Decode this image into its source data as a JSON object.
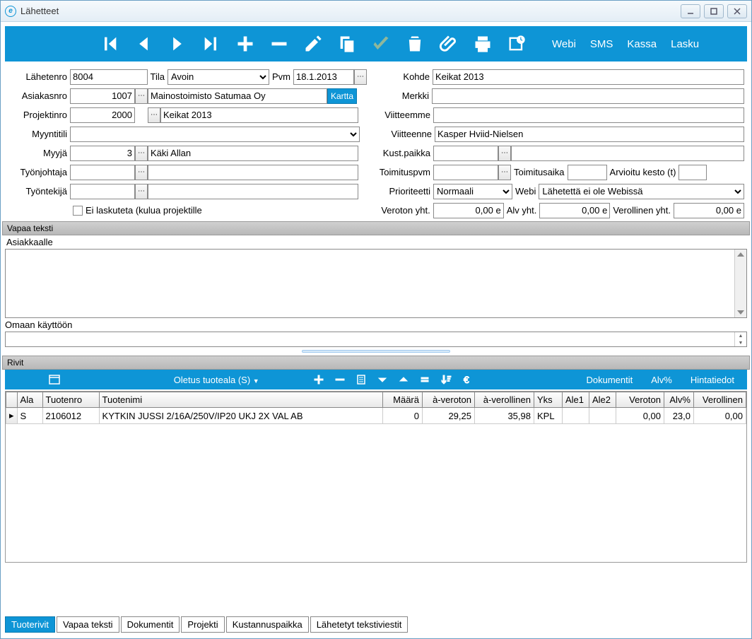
{
  "window": {
    "title": "Lähetteet"
  },
  "toolbar": {
    "links": [
      "Webi",
      "SMS",
      "Kassa",
      "Lasku"
    ]
  },
  "form": {
    "lahetenro_label": "Lähetenro",
    "lahetenro": "8004",
    "tila_label": "Tila",
    "tila": "Avoin",
    "pvm_label": "Pvm",
    "pvm": "18.1.2013",
    "kohde_label": "Kohde",
    "kohde": "Keikat 2013",
    "asiakasnro_label": "Asiakasnro",
    "asiakasnro": "1007",
    "asiakasnimi": "Mainostoimisto Satumaa Oy",
    "kartta_label": "Kartta",
    "merkki_label": "Merkki",
    "merkki": "",
    "projektinro_label": "Projektinro",
    "projektinro": "2000",
    "projektinimi": "Keikat 2013",
    "viitteemme_label": "Viitteemme",
    "viitteemme": "",
    "myyntitili_label": "Myyntitili",
    "viitteenne_label": "Viitteenne",
    "viitteenne": "Kasper Hviid-Nielsen",
    "myyja_label": "Myyjä",
    "myyja_nro": "3",
    "myyja_nimi": "Käki Allan",
    "kustpaikka_label": "Kust.paikka",
    "tyonjohtaja_label": "Työnjohtaja",
    "toimituspvm_label": "Toimituspvm",
    "toimitusaika_label": "Toimitusaika",
    "arvioitu_label": "Arvioitu kesto (t)",
    "tyontekija_label": "Työntekijä",
    "prioriteetti_label": "Prioriteetti",
    "prioriteetti": "Normaali",
    "webi_label": "Webi",
    "webi_status": "Lähetettä ei ole Webissä",
    "ei_laskuteta_label": "Ei laskuteta (kulua projektille",
    "veroton_yht_label": "Veroton yht.",
    "veroton_yht": "0,00 e",
    "alv_yht_label": "Alv yht.",
    "alv_yht": "0,00 e",
    "verollinen_yht_label": "Verollinen yht.",
    "verollinen_yht": "0,00 e"
  },
  "sections": {
    "vapaa_teksti": "Vapaa teksti",
    "asiakkaalle": "Asiakkaalle",
    "omaan_kayttoon": "Omaan käyttöön",
    "rivit": "Rivit"
  },
  "rivit_toolbar": {
    "oletus": "Oletus tuoteala (S)",
    "dokumentit": "Dokumentit",
    "alv": "Alv%",
    "hintatiedot": "Hintatiedot"
  },
  "grid": {
    "cols": [
      "Ala",
      "Tuotenro",
      "Tuotenimi",
      "Määrä",
      "à-veroton",
      "à-verollinen",
      "Yks",
      "Ale1",
      "Ale2",
      "Veroton",
      "Alv%",
      "Verollinen"
    ],
    "rows": [
      {
        "ala": "S",
        "tuotenro": "2106012",
        "tuotenimi": "KYTKIN JUSSI 2/16A/250V/IP20 UKJ 2X VAL AB",
        "maara": "0",
        "averoton": "29,25",
        "averollinen": "35,98",
        "yks": "KPL",
        "ale1": "",
        "ale2": "",
        "veroton": "0,00",
        "alv": "23,0",
        "verollinen": "0,00"
      }
    ]
  },
  "tabs": [
    "Tuoterivit",
    "Vapaa teksti",
    "Dokumentit",
    "Projekti",
    "Kustannuspaikka",
    "Lähetetyt tekstiviestit"
  ]
}
